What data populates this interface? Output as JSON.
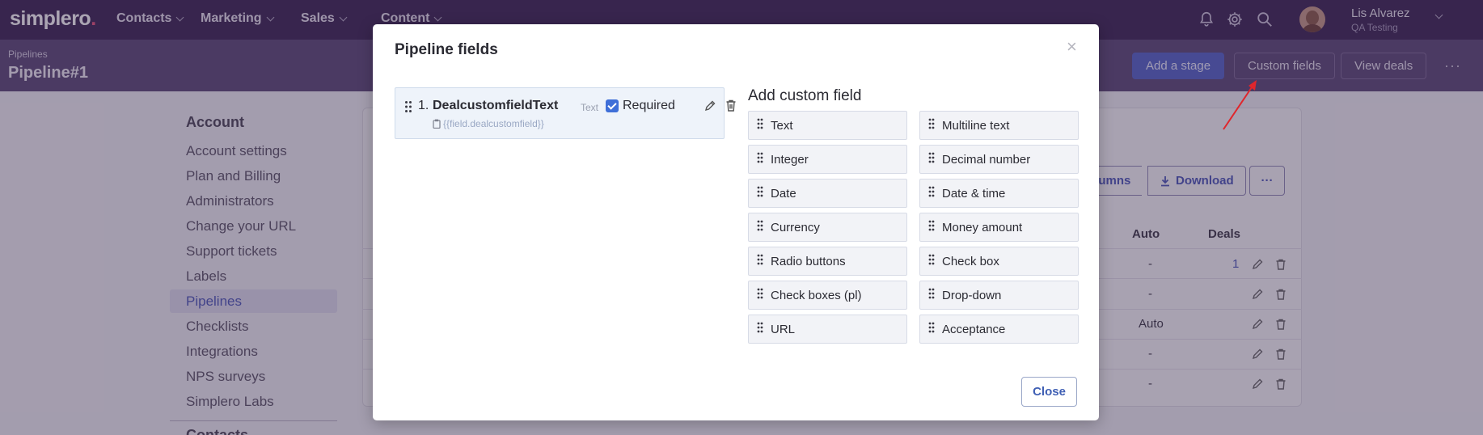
{
  "nav": {
    "logo_text": "simplero",
    "logo_dot": ".",
    "items": [
      {
        "label": "Contacts"
      },
      {
        "label": "Marketing"
      },
      {
        "label": "Sales"
      },
      {
        "label": "Content"
      }
    ],
    "user": {
      "name": "Lis Alvarez",
      "org": "QA Testing"
    }
  },
  "header": {
    "breadcrumb": "Pipelines",
    "title": "Pipeline#1",
    "buttons": {
      "add_stage": "Add a stage",
      "custom_fields": "Custom fields",
      "view_deals": "View deals",
      "more": "···"
    }
  },
  "sidebar": {
    "heading": "Account",
    "items": [
      {
        "label": "Account settings"
      },
      {
        "label": "Plan and Billing"
      },
      {
        "label": "Administrators"
      },
      {
        "label": "Change your URL"
      },
      {
        "label": "Support tickets"
      },
      {
        "label": "Labels"
      },
      {
        "label": "Pipelines"
      },
      {
        "label": "Checklists"
      },
      {
        "label": "Integrations"
      },
      {
        "label": "NPS surveys"
      },
      {
        "label": "Simplero Labs"
      }
    ],
    "heading2": "Contacts"
  },
  "background_table": {
    "columns_btn": "olumns",
    "download_btn": "Download",
    "more_btn": "···",
    "headers": {
      "auto": "Auto",
      "deals": "Deals"
    },
    "rows": [
      {
        "auto": "-",
        "deals": "1"
      },
      {
        "auto": "-",
        "deals": ""
      },
      {
        "auto": "Auto",
        "deals": ""
      },
      {
        "auto": "-",
        "deals": ""
      },
      {
        "auto": "-",
        "deals": ""
      }
    ]
  },
  "modal": {
    "title": "Pipeline fields",
    "close_x": "×",
    "field": {
      "number": "1.",
      "name": "DealcustomfieldText",
      "type": "Text",
      "token": "{{field.dealcustomfield}}",
      "required_label": "Required"
    },
    "add_custom_field": {
      "title": "Add custom field",
      "types": [
        "Text",
        "Multiline text",
        "Integer",
        "Decimal number",
        "Date",
        "Date & time",
        "Currency",
        "Money amount",
        "Radio buttons",
        "Check box",
        "Check boxes (pl)",
        "Drop-down",
        "URL",
        "Acceptance"
      ]
    },
    "close_button": "Close"
  },
  "colors": {
    "nav_bg": "#3a2352",
    "subheader_bg": "#5b4775",
    "primary": "#5362c9",
    "accent_link": "#4b57b9",
    "annotation_arrow": "#e0262c"
  }
}
